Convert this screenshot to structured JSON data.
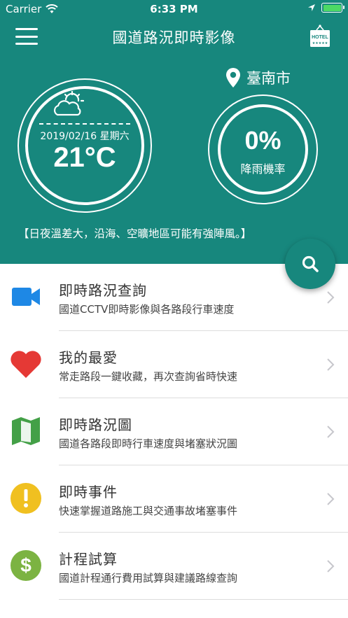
{
  "status_bar": {
    "carrier": "Carrier",
    "time": "6:33 PM",
    "battery_level": 1.0,
    "battery_color": "#4cd964"
  },
  "nav": {
    "title": "國道路況即時影像",
    "menu_icon": "hamburger-menu-icon",
    "hotel_icon": "hotel-sign-icon",
    "hotel_label": "HOTEL",
    "hotel_stars": "★★★★★"
  },
  "weather": {
    "icon": "sun-cloud-icon",
    "date": "2019/02/16 星期六",
    "temperature": "21°C",
    "city": "臺南市",
    "city_icon": "location-pin-icon",
    "rain_probability": "0%",
    "rain_label": "降雨機率",
    "notice": "【日夜溫差大，沿海、空曠地區可能有強陣風。】"
  },
  "search_fab": {
    "icon": "search-icon"
  },
  "colors": {
    "header_bg": "#17877d",
    "video_icon": "#1e88e5",
    "heart_icon": "#e53935",
    "map_icon": "#43a047",
    "alert_icon": "#f0c020",
    "dollar_icon": "#7cb342"
  },
  "menu": {
    "items": [
      {
        "title": "即時路況查詢",
        "subtitle": "國道CCTV即時影像與各路段行車速度",
        "icon": "video-camera-icon"
      },
      {
        "title": "我的最愛",
        "subtitle": "常走路段一鍵收藏，再次查詢省時快速",
        "icon": "heart-icon"
      },
      {
        "title": "即時路況圖",
        "subtitle": "國道各路段即時行車速度與堵塞狀況圖",
        "icon": "map-icon"
      },
      {
        "title": "即時事件",
        "subtitle": "快速掌握道路施工與交通事故堵塞事件",
        "icon": "alert-icon"
      },
      {
        "title": "計程試算",
        "subtitle": "國道計程通行費用試算與建議路線查詢",
        "icon": "dollar-icon"
      }
    ]
  }
}
